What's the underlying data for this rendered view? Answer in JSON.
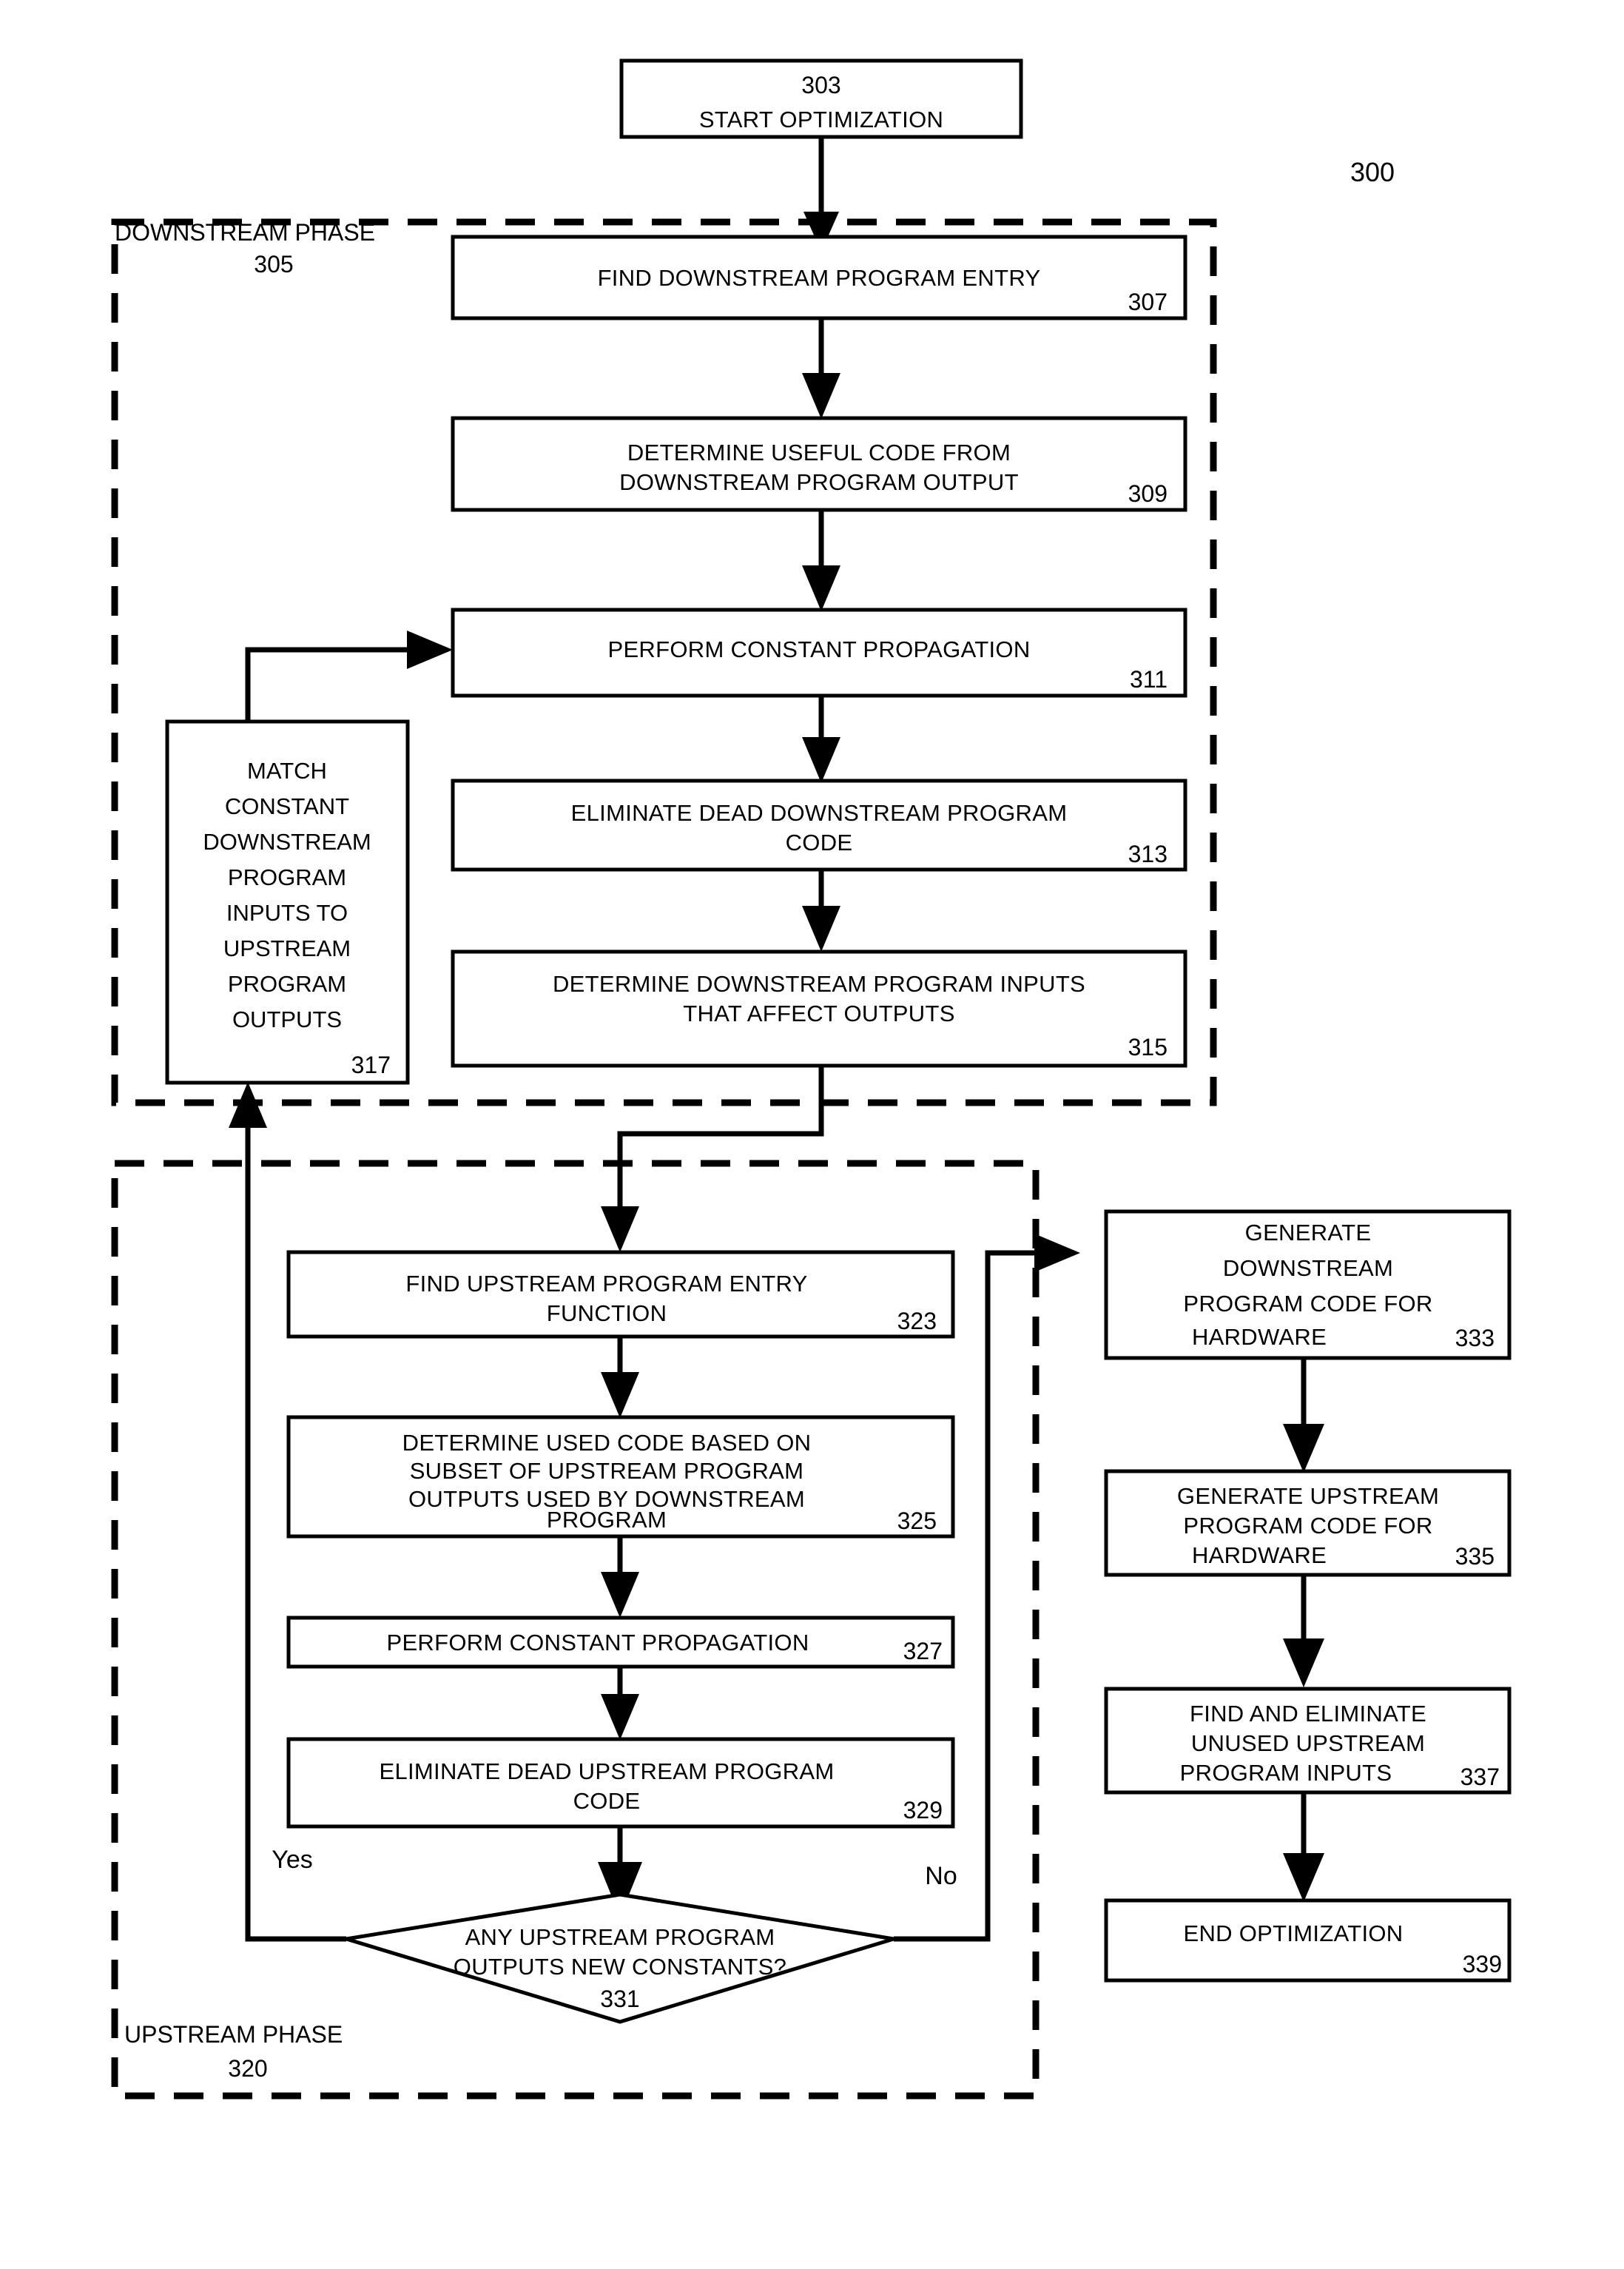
{
  "figure": {
    "number": "300"
  },
  "phases": [
    {
      "id": "downstream",
      "label": "DOWNSTREAM PHASE",
      "ref": "305"
    },
    {
      "id": "upstream",
      "label": "UPSTREAM PHASE",
      "ref": "320"
    }
  ],
  "nodes": {
    "start": {
      "ref": "303",
      "lines": [
        "START OPTIMIZATION"
      ]
    },
    "n307": {
      "ref": "307",
      "lines": [
        "FIND DOWNSTREAM PROGRAM ENTRY"
      ]
    },
    "n309": {
      "ref": "309",
      "lines": [
        "DETERMINE USEFUL CODE FROM",
        "DOWNSTREAM PROGRAM OUTPUT"
      ]
    },
    "n311": {
      "ref": "311",
      "lines": [
        "PERFORM CONSTANT PROPAGATION"
      ]
    },
    "n313": {
      "ref": "313",
      "lines": [
        "ELIMINATE DEAD DOWNSTREAM PROGRAM",
        "CODE"
      ]
    },
    "n315": {
      "ref": "315",
      "lines": [
        "DETERMINE DOWNSTREAM PROGRAM INPUTS",
        "THAT AFFECT OUTPUTS"
      ]
    },
    "n317": {
      "ref": "317",
      "lines": [
        "MATCH",
        "CONSTANT",
        "DOWNSTREAM",
        "PROGRAM",
        "INPUTS TO",
        "UPSTREAM",
        "PROGRAM",
        "OUTPUTS"
      ]
    },
    "n323": {
      "ref": "323",
      "lines": [
        "FIND UPSTREAM PROGRAM ENTRY",
        "FUNCTION"
      ]
    },
    "n325": {
      "ref": "325",
      "lines": [
        "DETERMINE USED CODE BASED ON",
        "SUBSET OF UPSTREAM PROGRAM",
        "OUTPUTS USED BY DOWNSTREAM",
        "PROGRAM"
      ]
    },
    "n327": {
      "ref": "327",
      "lines": [
        "PERFORM CONSTANT PROPAGATION"
      ]
    },
    "n329": {
      "ref": "329",
      "lines": [
        "ELIMINATE DEAD UPSTREAM PROGRAM",
        "CODE"
      ]
    },
    "n331": {
      "ref": "331",
      "lines": [
        "ANY UPSTREAM PROGRAM",
        "OUTPUTS NEW CONSTANTS?"
      ]
    },
    "n333": {
      "ref": "333",
      "lines": [
        "GENERATE",
        "DOWNSTREAM",
        "PROGRAM CODE FOR",
        "HARDWARE"
      ]
    },
    "n335": {
      "ref": "335",
      "lines": [
        "GENERATE UPSTREAM",
        "PROGRAM CODE FOR",
        "HARDWARE"
      ]
    },
    "n337": {
      "ref": "337",
      "lines": [
        "FIND AND ELIMINATE",
        "UNUSED UPSTREAM",
        "PROGRAM INPUTS"
      ]
    },
    "n339": {
      "ref": "339",
      "lines": [
        "END OPTIMIZATION"
      ]
    }
  },
  "branches": {
    "yes": "Yes",
    "no": "No"
  },
  "colors": {
    "ink": "#000000",
    "paper": "#ffffff"
  }
}
